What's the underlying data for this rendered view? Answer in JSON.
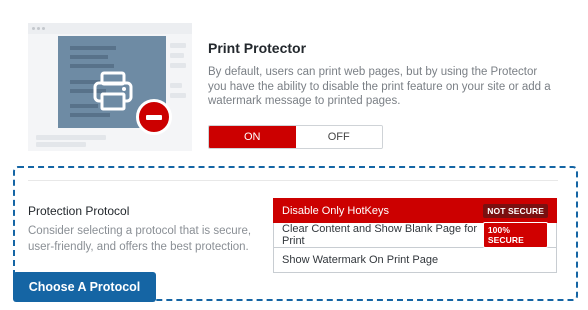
{
  "print_protector": {
    "title": "Print Protector",
    "description": "By default, users can print web pages, but by using the Protector you have the ability to disable the print feature on your site or add a watermark message to printed pages.",
    "toggle": {
      "on_label": "ON",
      "off_label": "OFF",
      "selected": "ON"
    }
  },
  "protection_protocol": {
    "title": "Protection Protocol",
    "description": "Consider selecting a protocol that is secure, user-friendly, and offers the best protection.",
    "options": [
      {
        "label": "Disable Only HotKeys",
        "badge": "NOT SECURE",
        "selected": true
      },
      {
        "label": "Clear Content and Show Blank Page for Print",
        "badge": "100% SECURE",
        "selected": false
      },
      {
        "label": "Show Watermark On Print Page",
        "badge": "",
        "selected": false
      }
    ]
  },
  "callout": {
    "label": "Choose A Protocol"
  },
  "icons": {
    "illustration": "printer-blocked-icon",
    "printer": "printer-icon",
    "stop": "no-entry-icon"
  },
  "colors": {
    "accent_red": "#cc0000",
    "accent_blue": "#1565a4",
    "badge_dark": "#7a1010"
  }
}
